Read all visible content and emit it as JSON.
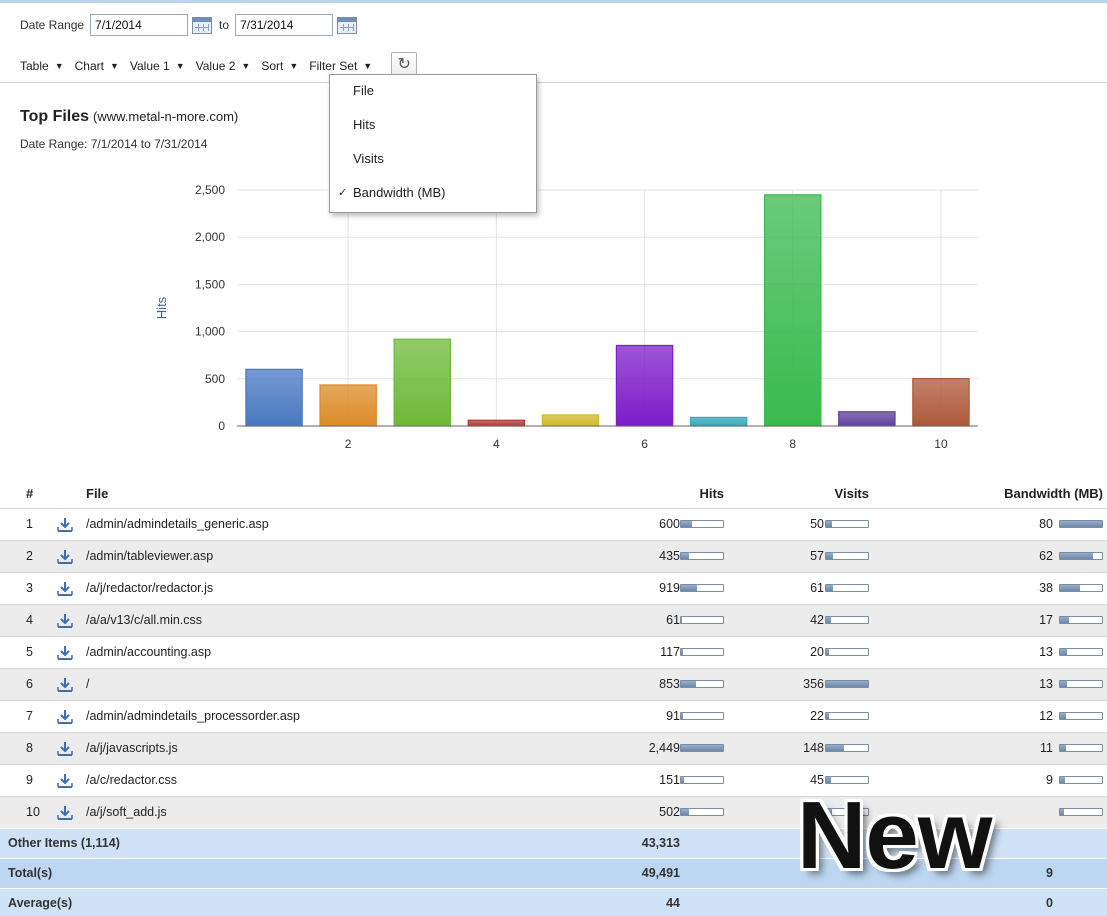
{
  "toolbar": {
    "date_range_label": "Date Range",
    "date_from": "7/1/2014",
    "to_label": "to",
    "date_to": "7/31/2014",
    "menus": [
      "Table",
      "Chart",
      "Value 1",
      "Value 2",
      "Sort",
      "Filter Set"
    ],
    "refresh_icon": "refresh-icon"
  },
  "sort_dropdown": {
    "items": [
      {
        "label": "File",
        "checked": false
      },
      {
        "label": "Hits",
        "checked": false
      },
      {
        "label": "Visits",
        "checked": false
      },
      {
        "label": "Bandwidth (MB)",
        "checked": true
      }
    ],
    "check_glyph": "✓"
  },
  "report": {
    "title": "Top Files",
    "site": "(www.metal-n-more.com)",
    "subtitle": "Date Range:  7/1/2014 to 7/31/2014"
  },
  "chart_data": {
    "type": "bar",
    "ylabel": "Hits",
    "xlabel": "",
    "x": [
      1,
      2,
      3,
      4,
      5,
      6,
      7,
      8,
      9,
      10
    ],
    "x_tick_labels": [
      "2",
      "4",
      "6",
      "8",
      "10"
    ],
    "x_ticks": [
      2,
      4,
      6,
      8,
      10
    ],
    "y_ticks": [
      0,
      500,
      1000,
      1500,
      2000,
      2500
    ],
    "y_tick_labels": [
      "0",
      "500",
      "1,000",
      "1,500",
      "2,000",
      "2,500"
    ],
    "ylim": [
      0,
      2500
    ],
    "values": [
      600,
      435,
      919,
      61,
      117,
      853,
      91,
      2449,
      151,
      502
    ],
    "colors": [
      "#4f86d6",
      "#f49a2a",
      "#7acd3e",
      "#c8413f",
      "#e8cf2f",
      "#8a1fe0",
      "#3fb8d0",
      "#3fcf56",
      "#6a48b0",
      "#c0633f"
    ],
    "grid": true
  },
  "table": {
    "headers": {
      "num": "#",
      "file": "File",
      "hits": "Hits",
      "visits": "Visits",
      "bandwidth": "Bandwidth (MB)"
    },
    "download_icon": "download-icon",
    "rows": [
      {
        "num": "1",
        "file": "/admin/admindetails_generic.asp",
        "hits": "600",
        "hits_frac": 0.245,
        "visits": "50",
        "visits_frac": 0.14,
        "bw": "80",
        "bw_frac": 1.0
      },
      {
        "num": "2",
        "file": "/admin/tableviewer.asp",
        "hits": "435",
        "hits_frac": 0.18,
        "visits": "57",
        "visits_frac": 0.16,
        "bw": "62",
        "bw_frac": 0.78
      },
      {
        "num": "3",
        "file": "/a/j/redactor/redactor.js",
        "hits": "919",
        "hits_frac": 0.375,
        "visits": "61",
        "visits_frac": 0.17,
        "bw": "38",
        "bw_frac": 0.48
      },
      {
        "num": "4",
        "file": "/a/a/v13/c/all.min.css",
        "hits": "61",
        "hits_frac": 0.025,
        "visits": "42",
        "visits_frac": 0.12,
        "bw": "17",
        "bw_frac": 0.21
      },
      {
        "num": "5",
        "file": "/admin/accounting.asp",
        "hits": "117",
        "hits_frac": 0.05,
        "visits": "20",
        "visits_frac": 0.06,
        "bw": "13",
        "bw_frac": 0.16
      },
      {
        "num": "6",
        "file": "/",
        "hits": "853",
        "hits_frac": 0.35,
        "visits": "356",
        "visits_frac": 1.0,
        "bw": "13",
        "bw_frac": 0.16
      },
      {
        "num": "7",
        "file": "/admin/admindetails_processorder.asp",
        "hits": "91",
        "hits_frac": 0.04,
        "visits": "22",
        "visits_frac": 0.06,
        "bw": "12",
        "bw_frac": 0.15
      },
      {
        "num": "8",
        "file": "/a/j/javascripts.js",
        "hits": "2,449",
        "hits_frac": 1.0,
        "visits": "148",
        "visits_frac": 0.42,
        "bw": "11",
        "bw_frac": 0.14
      },
      {
        "num": "9",
        "file": "/a/c/redactor.css",
        "hits": "151",
        "hits_frac": 0.06,
        "visits": "45",
        "visits_frac": 0.13,
        "bw": "9",
        "bw_frac": 0.11
      },
      {
        "num": "10",
        "file": "/a/j/soft_add.js",
        "hits": "502",
        "hits_frac": 0.2,
        "visits": "",
        "visits_frac": 0.14,
        "bw": "",
        "bw_frac": 0.1
      }
    ],
    "summary": [
      {
        "label": "Other Items (1,114)",
        "hits": "43,313",
        "visits": "",
        "bw": ""
      },
      {
        "label": "Total(s)",
        "hits": "49,491",
        "visits": "",
        "bw": "9"
      },
      {
        "label": "Average(s)",
        "hits": "44",
        "visits": "",
        "bw": "0"
      }
    ]
  },
  "overlay": {
    "text": "New"
  }
}
